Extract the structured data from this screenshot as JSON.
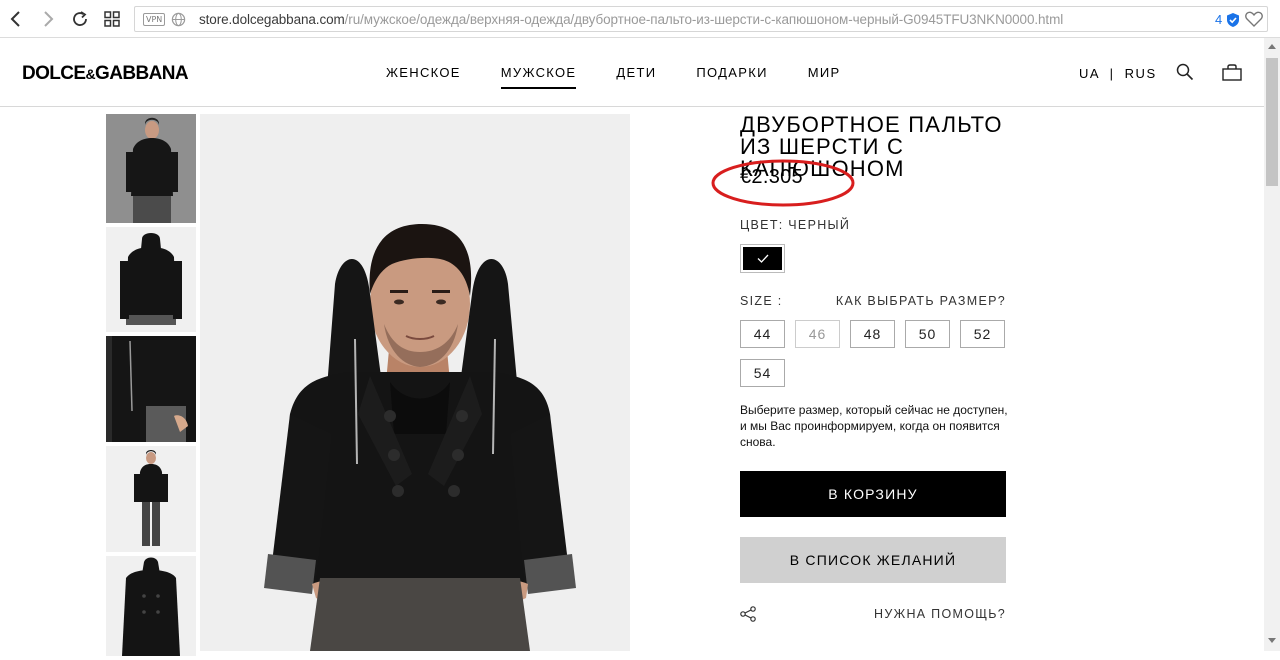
{
  "browser": {
    "vpn_label": "VPN",
    "url_host": "store.dolcegabbana.com",
    "url_path": "/ru/мужское/одежда/верхняя-одежда/двубортное-пальто-из-шерсти-с-капюшоном-черный-G0945TFU3NKN0000.html",
    "badge_count": "4"
  },
  "header": {
    "logo_left": "DOLCE",
    "logo_amp": "&",
    "logo_right": "GABBANA",
    "nav": [
      {
        "label": "ЖЕНСКОЕ",
        "active": false
      },
      {
        "label": "МУЖСКОЕ",
        "active": true
      },
      {
        "label": "ДЕТИ",
        "active": false
      },
      {
        "label": "ПОДАРКИ",
        "active": false
      },
      {
        "label": "МИР",
        "active": false
      }
    ],
    "lang": "UA  |  RUS"
  },
  "product": {
    "title": "ДВУБОРТНОЕ ПАЛЬТО ИЗ ШЕРСТИ С КАПЮШОНОМ",
    "price": "€2.305",
    "color_label": "ЦВЕТ: ЧЕРНЫЙ",
    "size_label": "SIZE :",
    "size_help": "КАК ВЫБРАТЬ РАЗМЕР?",
    "sizes": [
      {
        "label": "44",
        "available": true
      },
      {
        "label": "46",
        "available": false
      },
      {
        "label": "48",
        "available": true
      },
      {
        "label": "50",
        "available": true
      },
      {
        "label": "52",
        "available": true
      },
      {
        "label": "54",
        "available": true
      }
    ],
    "note": "Выберите размер, который сейчас не доступен, и мы Вас проинформируем, когда он появится снова.",
    "cart_button": "В КОРЗИНУ",
    "wishlist_button": "В СПИСОК ЖЕЛАНИЙ",
    "help_link": "НУЖНА ПОМОЩЬ?"
  },
  "colors": {
    "annotation_circle": "#d81e1e",
    "primary_button": "#000000",
    "secondary_button": "#d0d0d0"
  }
}
